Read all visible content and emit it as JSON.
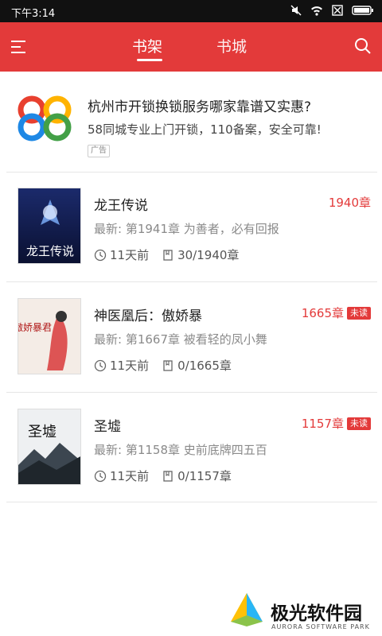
{
  "status": {
    "time": "下午3:14"
  },
  "header": {
    "tabs": [
      {
        "label": "书架"
      },
      {
        "label": "书城"
      }
    ]
  },
  "ad": {
    "title": "杭州市开锁换锁服务哪家靠谱又实惠?",
    "desc": "58同城专业上门开锁，110备案，安全可靠!",
    "badge": "广告"
  },
  "books": [
    {
      "title": "龙王传说",
      "chapters": "1940章",
      "unread": "",
      "latest": "最新: 第1941章 为善者，必有回报",
      "updated": "11天前",
      "progress": "30/1940章",
      "cover_text": "龙王传说"
    },
    {
      "title": "神医凰后：傲娇暴",
      "chapters": "1665章",
      "unread": "未读",
      "latest": "最新: 第1667章 被看轻的凤小舞",
      "updated": "11天前",
      "progress": "0/1665章",
      "cover_text": "傲娇暴君"
    },
    {
      "title": "圣墟",
      "chapters": "1157章",
      "unread": "未读",
      "latest": "最新: 第1158章 史前底牌四五百",
      "updated": "11天前",
      "progress": "0/1157章",
      "cover_text": "圣墟"
    }
  ],
  "footer": {
    "name": "极光软件园",
    "sub": "AURORA SOFTWARE PARK"
  },
  "colors": {
    "accent": "#e33a3a"
  }
}
